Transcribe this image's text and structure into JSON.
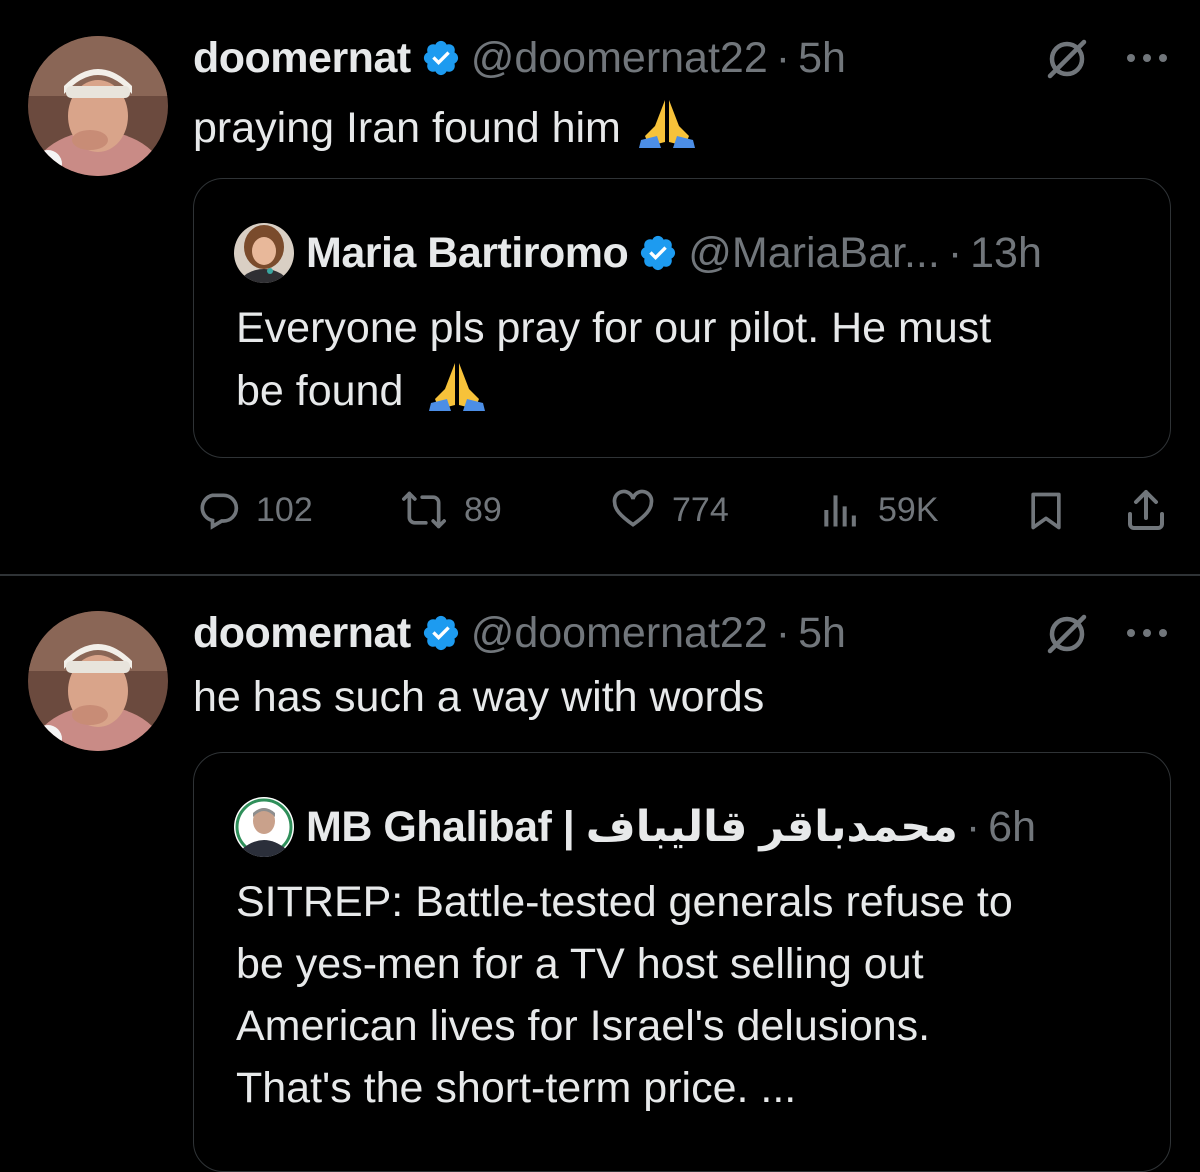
{
  "tweets": [
    {
      "name": "doomernat",
      "handle": "@doomernat22",
      "dot": "·",
      "time": "5h",
      "text": "praying Iran found him",
      "quote": {
        "name": "Maria Bartiromo",
        "handle": "@MariaBar...",
        "dot": "·",
        "time": "13h",
        "text_line1": "Everyone pls pray for our pilot. He must",
        "text_line2": "be found"
      },
      "actions": {
        "replies": "102",
        "reposts": "89",
        "likes": "774",
        "views": "59K"
      }
    },
    {
      "name": "doomernat",
      "handle": "@doomernat22",
      "dot": "·",
      "time": "5h",
      "text": "he has such a way with words",
      "quote": {
        "name": "MB Ghalibaf | محمدباقر قالیباف",
        "dot": "·",
        "time": "6h",
        "text_lines": [
          "SITREP: Battle-tested generals refuse to",
          "be yes-men for a TV host selling out",
          "American lives for Israel's delusions.",
          "That's the short-term price. ..."
        ]
      }
    }
  ],
  "colors": {
    "background": "#000000",
    "text": "#e7e9ea",
    "secondary": "#71767b",
    "verified": "#1d9bf0",
    "border": "#2f3336"
  },
  "icons": [
    "verified-badge-icon",
    "grok-icon",
    "more-icon",
    "reply-icon",
    "repost-icon",
    "like-icon",
    "views-icon",
    "bookmark-icon",
    "share-icon",
    "pray-emoji-icon"
  ]
}
